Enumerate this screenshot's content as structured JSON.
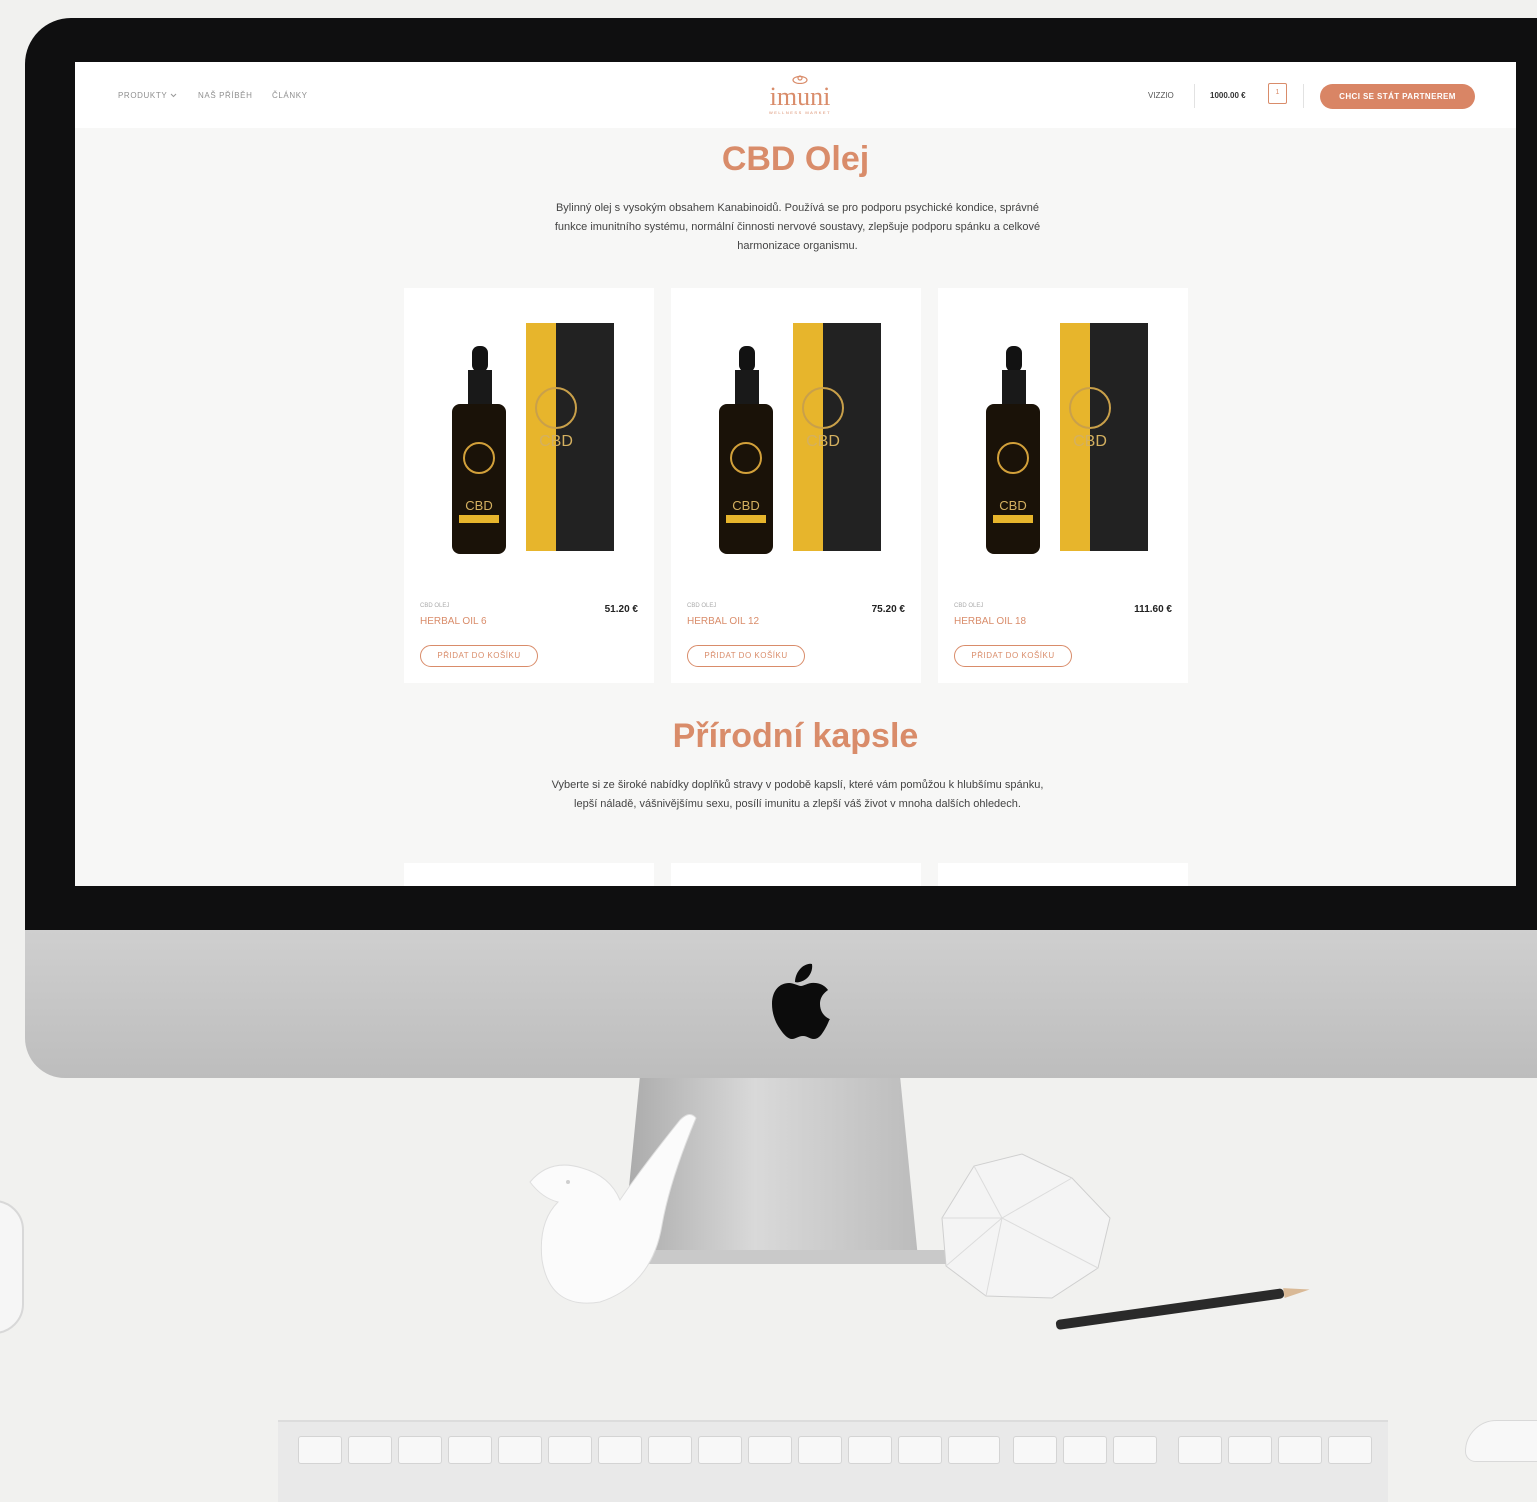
{
  "header": {
    "nav": [
      {
        "label": "PRODUKTY"
      },
      {
        "label": "NAŠ PŘÍBĚH"
      },
      {
        "label": "ČLÁNKY"
      }
    ],
    "logo": {
      "word": "imuni",
      "tagline": "WELLNESS MARKET"
    },
    "account_label": "VIZZIO",
    "cart_total": "1000.00 €",
    "cart_count": "1",
    "cta_label": "CHCI SE STÁT PARTNEREM"
  },
  "sections": [
    {
      "title": "CBD Olej",
      "description": "Bylinný olej s vysokým obsahem Kanabinoidů. Používá se pro podporu psychické kondice, správné funkce imunitního systému, normální činnosti nervové soustavy, zlepšuje podporu spánku a celkové harmonizace organismu.",
      "products": [
        {
          "category": "CBD OLEJ",
          "name": "HERBAL OIL 6",
          "price": "51.20 €",
          "button": "PŘIDAT DO KOŠÍKU"
        },
        {
          "category": "CBD OLEJ",
          "name": "HERBAL OIL 12",
          "price": "75.20 €",
          "button": "PŘIDAT DO KOŠÍKU"
        },
        {
          "category": "CBD OLEJ",
          "name": "HERBAL OIL 18",
          "price": "111.60 €",
          "button": "PŘIDAT DO KOŠÍKU"
        }
      ]
    },
    {
      "title": "Přírodní kapsle",
      "description": "Vyberte si ze široké nabídky doplňků stravy v podobě kapslí, které vám pomůžou k hlubšímu spánku, lepší náladě, vášnivějšímu sexu, posílí imunitu a zlepší váš život v mnoha dalších ohledech."
    }
  ],
  "colors": {
    "accent": "#d98c6a",
    "button_fill": "#d98565",
    "box_gold": "#e7b52c"
  },
  "icons": {
    "chevron": "chevron-down-icon",
    "cart": "shopping-bag-icon",
    "brand": "apple-logo-icon"
  }
}
